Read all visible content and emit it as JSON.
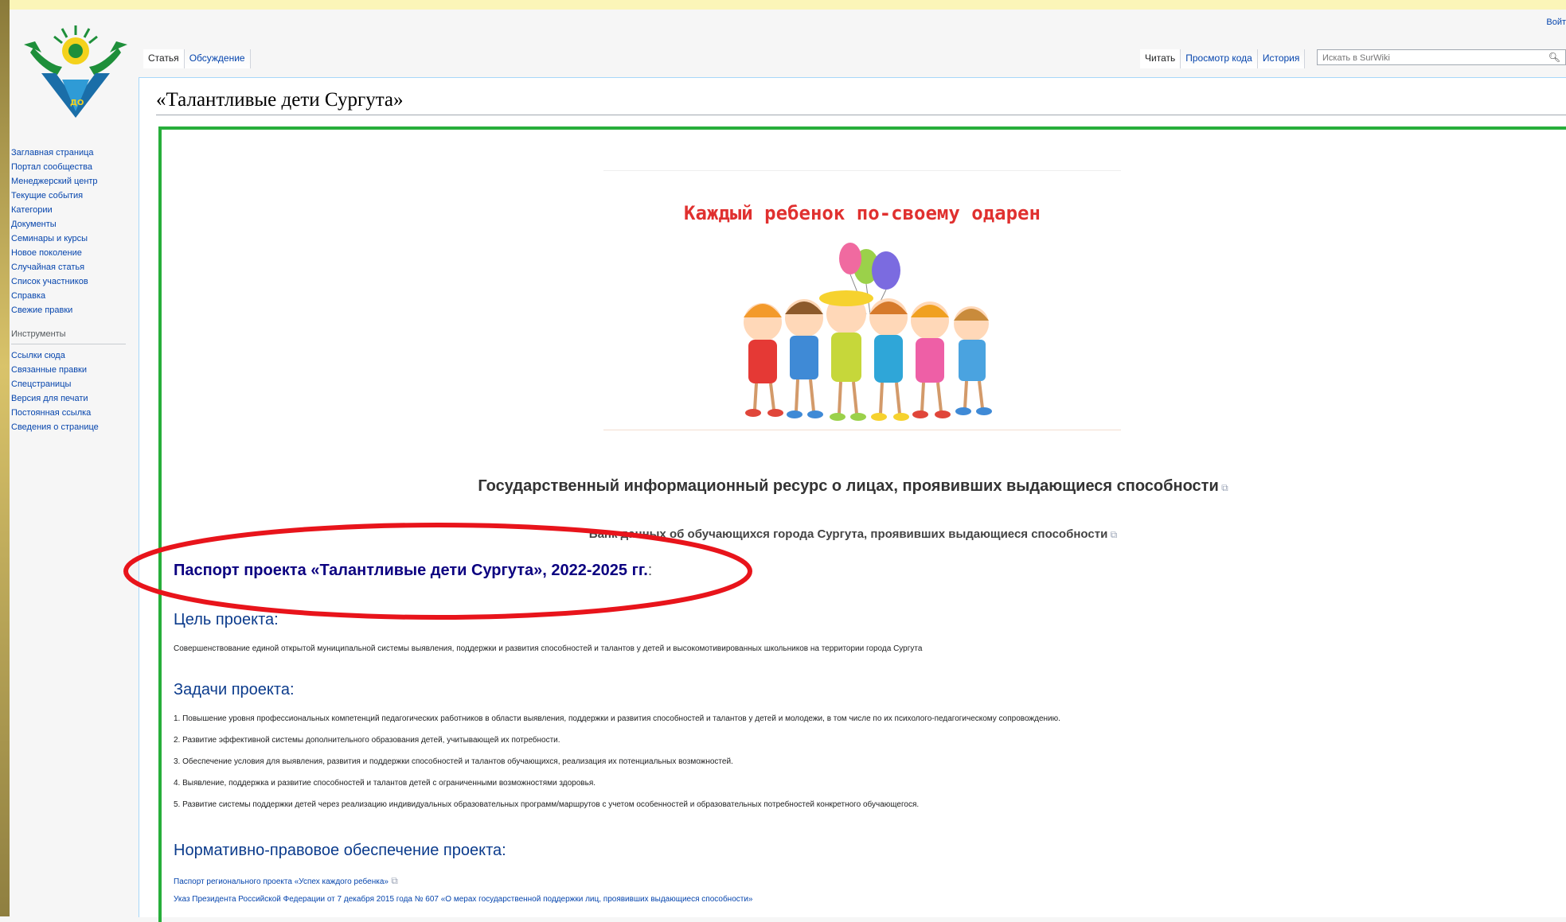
{
  "header": {
    "login_label": "Войт"
  },
  "tabs": {
    "article": "Статья",
    "discussion": "Обсуждение",
    "read": "Читать",
    "view_source": "Просмотр кода",
    "history": "История"
  },
  "search": {
    "placeholder": "Искать в SurWiki"
  },
  "sidebar": {
    "navigation": [
      "Заглавная страница",
      "Портал сообщества",
      "Менеджерский центр",
      "Текущие события",
      "Категории",
      "Документы",
      "Семинары и курсы",
      "Новое поколение",
      "Случайная статья",
      "Список участников",
      "Справка",
      "Свежие правки"
    ],
    "tools_heading": "Инструменты",
    "tools": [
      "Ссылки сюда",
      "Связанные правки",
      "Спецстраницы",
      "Версия для печати",
      "Постоянная ссылка",
      "Сведения о странице"
    ]
  },
  "page": {
    "title": "«Талантливые дети Сургута»",
    "slogan": "Каждый ребенок по-своему одарен",
    "gir_link": "Государственный информационный ресурс о лицах, проявивших выдающиеся способности",
    "bank_link": "Банк данных об обучающихся города Сургута, проявивших выдающиеся способности",
    "passport_link": "Паспорт проекта «Талантливые дети Сургута», 2022-2025 гг.",
    "passport_suffix": ":",
    "goal_heading": "Цель проекта:",
    "goal_text": "Совершенствование единой открытой муниципальной системы выявления, поддержки и развития способностей и талантов у детей и высокомотивированных школьников на территории города Сургута",
    "tasks_heading": "Задачи проекта:",
    "tasks": [
      "1. Повышение уровня профессиональных компетенций педагогических работников в области выявления, поддержки и развития способностей и талантов у детей и молодежи, в том числе по их психолого-педагогическому сопровождению.",
      "2. Развитие эффективной системы дополнительного образования детей, учитывающей их потребности.",
      "3. Обеспечение условия для выявления, развития и поддержки способностей и талантов обучающихся, реализация их потенциальных возможностей.",
      "4. Выявление, поддержка и развитие способностей и талантов детей с ограниченными возможностями здоровья.",
      "5. Развитие системы поддержки детей через реализацию индивидуальных образовательных программ/маршрутов с учетом особенностей и образовательных потребностей конкретного обучающегося."
    ],
    "legal_heading": "Нормативно-правовое обеспечение проекта:",
    "legal_links": [
      "Паспорт регионального проекта «Успех каждого ребенка»",
      "Указ Президента Российской Федерации от 7 декабря 2015 года № 607 «О мерах государственной поддержки лиц, проявивших выдающиеся способности»"
    ]
  },
  "colors": {
    "link": "#0645ad",
    "slogan": "#e0302f",
    "highlight_ellipse": "#e8141b",
    "green_border": "#27ae3a"
  }
}
